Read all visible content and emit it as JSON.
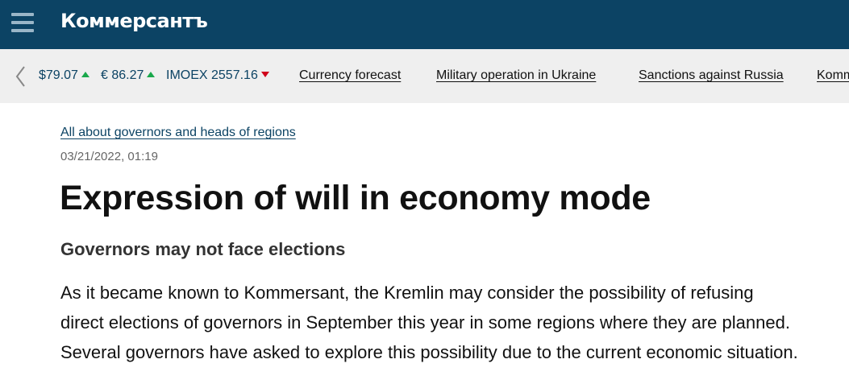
{
  "header": {
    "logo": "Коммерсантъ",
    "menu_icon": "hamburger-menu-icon",
    "background_color": "#0c4364"
  },
  "ticker": {
    "prev_icon": "chevron-left-icon",
    "quotes": [
      {
        "label": "$79.07",
        "trend": "up"
      },
      {
        "label": "€ 86.27",
        "trend": "up"
      },
      {
        "label": "IMOEX 2557.16",
        "trend": "down"
      }
    ],
    "links": [
      "Currency forecast",
      "Military operation in Ukraine",
      "Sanctions against Russia",
      "Komm"
    ],
    "up_color": "#1aa84b",
    "down_color": "#d0021b"
  },
  "article": {
    "rubric": "All about governors and heads of regions",
    "date": "03/21/2022, 01:19",
    "title": "Expression of will in economy mode",
    "subtitle": "Governors may not face elections",
    "lead_lines": [
      "As it became known to Kommersant, the Kremlin may consider the possibility of refusing",
      "direct elections of governors in September this year in some regions where they are planned.",
      "Several governors have asked to explore this possibility due to the current economic situation."
    ]
  }
}
